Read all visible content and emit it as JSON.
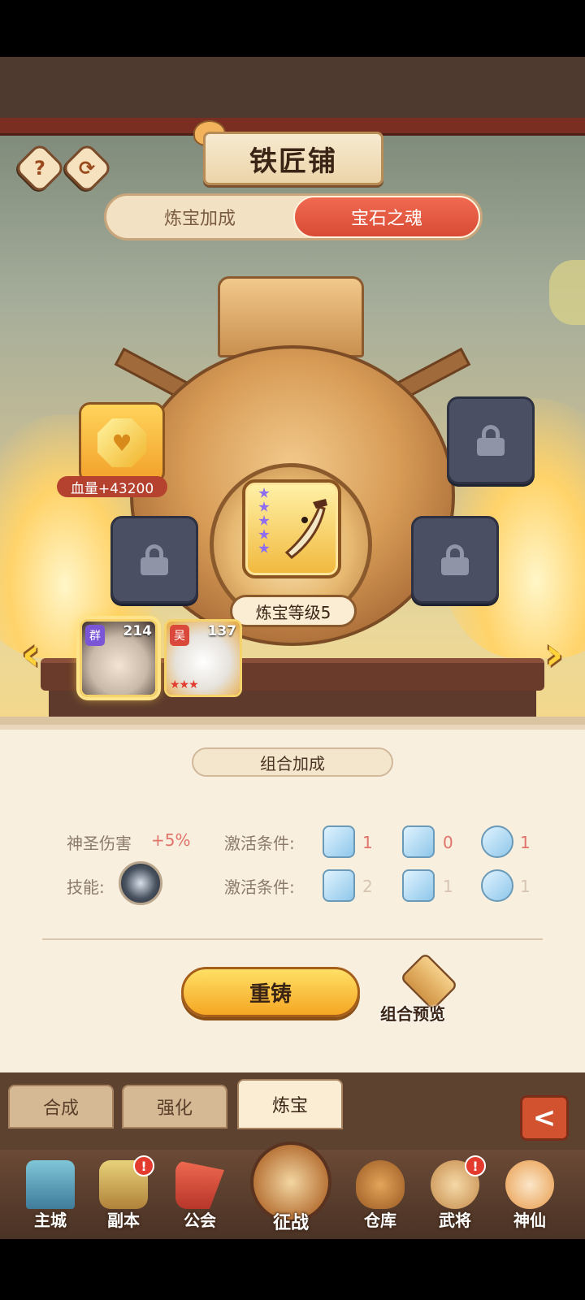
{
  "screen_title": "铁匠铺",
  "top_buttons": {
    "help": "?",
    "refresh": "⟳"
  },
  "tabs": [
    {
      "label": "炼宝加成",
      "active": false
    },
    {
      "label": "宝石之魂",
      "active": true
    }
  ],
  "forge": {
    "level_label": "炼宝等级5",
    "stars": 5,
    "gem_bonus_label": "血量+43200",
    "gem_icon": "heart-gem-icon",
    "locked_slots": 3
  },
  "heroes": [
    {
      "faction": "群",
      "faction_color": "#7a55d6",
      "level": "214",
      "selected": true
    },
    {
      "faction": "吴",
      "faction_color": "#d9483a",
      "level": "137",
      "selected": false,
      "stars": "★★★"
    }
  ],
  "nav_arrows": {
    "left": "‹",
    "right": "›"
  },
  "combo": {
    "section_title": "组合加成",
    "bonus_name": "神圣伤害",
    "bonus_value": "+5%",
    "skill_label": "技能:",
    "conditions": [
      {
        "label": "激活条件:",
        "counts": [
          "1",
          "0",
          "1"
        ]
      },
      {
        "label": "激活条件:",
        "counts": [
          "2",
          "1",
          "1"
        ]
      }
    ]
  },
  "actions": {
    "reforge": "重铸",
    "preview": "组合预览"
  },
  "bottom_tabs": [
    {
      "label": "合成",
      "active": false
    },
    {
      "label": "强化",
      "active": false
    },
    {
      "label": "炼宝",
      "active": true
    }
  ],
  "back_button": "<",
  "nav": [
    {
      "label": "主城",
      "icon": "castle-icon",
      "badge": ""
    },
    {
      "label": "副本",
      "icon": "sword-icon",
      "badge": "!"
    },
    {
      "label": "公会",
      "icon": "flag-icon",
      "badge": ""
    },
    {
      "label": "征战",
      "icon": "battle-icon",
      "badge": ""
    },
    {
      "label": "仓库",
      "icon": "bag-icon",
      "badge": ""
    },
    {
      "label": "武将",
      "icon": "cat-general-icon",
      "badge": "!"
    },
    {
      "label": "神仙",
      "icon": "cat-immortal-icon",
      "badge": ""
    }
  ],
  "colors": {
    "accent": "#d94b36",
    "gold": "#f5a623",
    "panel": "#f8efdf"
  }
}
